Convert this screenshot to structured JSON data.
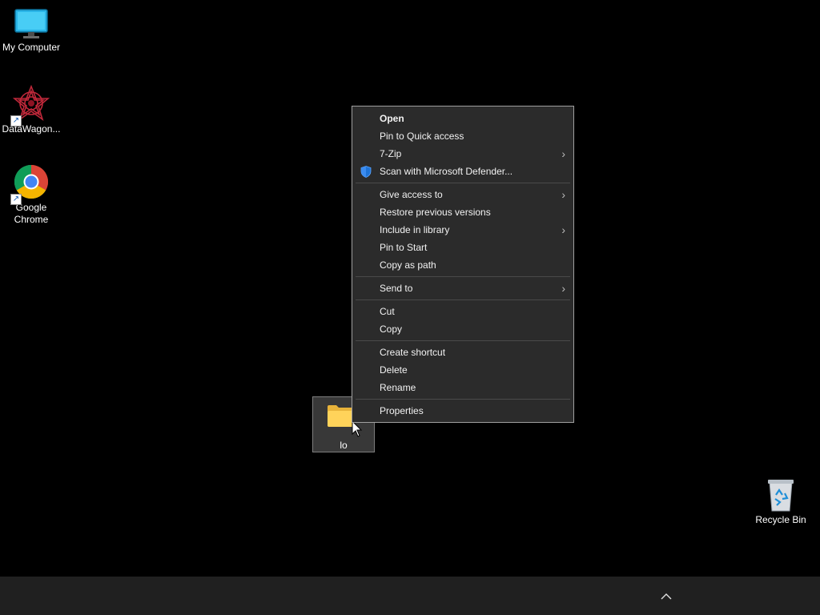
{
  "desktop": {
    "icons": [
      {
        "label": "My Computer",
        "icon": "monitor-icon"
      },
      {
        "label": "DataWagon...",
        "icon": "datawagon-logo-icon"
      },
      {
        "label": "Google Chrome",
        "icon": "chrome-icon"
      },
      {
        "label": "Recycle Bin",
        "icon": "recycle-bin-icon"
      }
    ],
    "selected_folder": {
      "label": "lo",
      "icon": "folder-icon"
    }
  },
  "context_menu": {
    "groups": [
      [
        {
          "label": "Open",
          "bold": true
        },
        {
          "label": "Pin to Quick access"
        },
        {
          "label": "7-Zip",
          "submenu": true
        },
        {
          "label": "Scan with Microsoft Defender...",
          "icon": "defender-shield-icon"
        }
      ],
      [
        {
          "label": "Give access to",
          "submenu": true
        },
        {
          "label": "Restore previous versions"
        },
        {
          "label": "Include in library",
          "submenu": true
        },
        {
          "label": "Pin to Start"
        },
        {
          "label": "Copy as path"
        }
      ],
      [
        {
          "label": "Send to",
          "submenu": true
        }
      ],
      [
        {
          "label": "Cut"
        },
        {
          "label": "Copy"
        }
      ],
      [
        {
          "label": "Create shortcut"
        },
        {
          "label": "Delete"
        },
        {
          "label": "Rename"
        }
      ],
      [
        {
          "label": "Properties"
        }
      ]
    ],
    "colors": {
      "background": "#2b2b2b",
      "border": "#a0a0a0",
      "text": "#f2f2f2"
    }
  },
  "taskbar": {
    "tray_icon": "chevron-up-icon",
    "colors": {
      "background": "#202020"
    }
  }
}
